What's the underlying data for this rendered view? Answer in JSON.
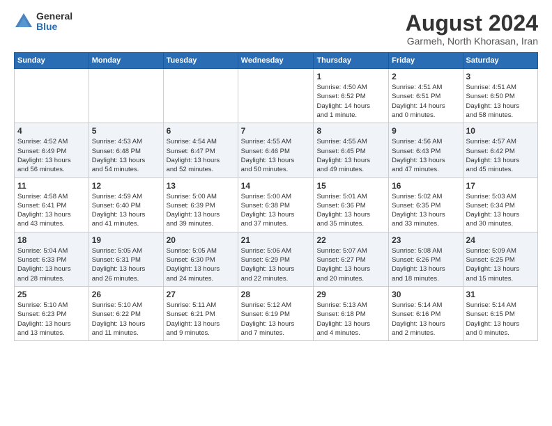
{
  "logo": {
    "general": "General",
    "blue": "Blue"
  },
  "title": "August 2024",
  "subtitle": "Garmeh, North Khorasan, Iran",
  "headers": [
    "Sunday",
    "Monday",
    "Tuesday",
    "Wednesday",
    "Thursday",
    "Friday",
    "Saturday"
  ],
  "weeks": [
    [
      {
        "day": "",
        "info": ""
      },
      {
        "day": "",
        "info": ""
      },
      {
        "day": "",
        "info": ""
      },
      {
        "day": "",
        "info": ""
      },
      {
        "day": "1",
        "info": "Sunrise: 4:50 AM\nSunset: 6:52 PM\nDaylight: 14 hours\nand 1 minute."
      },
      {
        "day": "2",
        "info": "Sunrise: 4:51 AM\nSunset: 6:51 PM\nDaylight: 14 hours\nand 0 minutes."
      },
      {
        "day": "3",
        "info": "Sunrise: 4:51 AM\nSunset: 6:50 PM\nDaylight: 13 hours\nand 58 minutes."
      }
    ],
    [
      {
        "day": "4",
        "info": "Sunrise: 4:52 AM\nSunset: 6:49 PM\nDaylight: 13 hours\nand 56 minutes."
      },
      {
        "day": "5",
        "info": "Sunrise: 4:53 AM\nSunset: 6:48 PM\nDaylight: 13 hours\nand 54 minutes."
      },
      {
        "day": "6",
        "info": "Sunrise: 4:54 AM\nSunset: 6:47 PM\nDaylight: 13 hours\nand 52 minutes."
      },
      {
        "day": "7",
        "info": "Sunrise: 4:55 AM\nSunset: 6:46 PM\nDaylight: 13 hours\nand 50 minutes."
      },
      {
        "day": "8",
        "info": "Sunrise: 4:55 AM\nSunset: 6:45 PM\nDaylight: 13 hours\nand 49 minutes."
      },
      {
        "day": "9",
        "info": "Sunrise: 4:56 AM\nSunset: 6:43 PM\nDaylight: 13 hours\nand 47 minutes."
      },
      {
        "day": "10",
        "info": "Sunrise: 4:57 AM\nSunset: 6:42 PM\nDaylight: 13 hours\nand 45 minutes."
      }
    ],
    [
      {
        "day": "11",
        "info": "Sunrise: 4:58 AM\nSunset: 6:41 PM\nDaylight: 13 hours\nand 43 minutes."
      },
      {
        "day": "12",
        "info": "Sunrise: 4:59 AM\nSunset: 6:40 PM\nDaylight: 13 hours\nand 41 minutes."
      },
      {
        "day": "13",
        "info": "Sunrise: 5:00 AM\nSunset: 6:39 PM\nDaylight: 13 hours\nand 39 minutes."
      },
      {
        "day": "14",
        "info": "Sunrise: 5:00 AM\nSunset: 6:38 PM\nDaylight: 13 hours\nand 37 minutes."
      },
      {
        "day": "15",
        "info": "Sunrise: 5:01 AM\nSunset: 6:36 PM\nDaylight: 13 hours\nand 35 minutes."
      },
      {
        "day": "16",
        "info": "Sunrise: 5:02 AM\nSunset: 6:35 PM\nDaylight: 13 hours\nand 33 minutes."
      },
      {
        "day": "17",
        "info": "Sunrise: 5:03 AM\nSunset: 6:34 PM\nDaylight: 13 hours\nand 30 minutes."
      }
    ],
    [
      {
        "day": "18",
        "info": "Sunrise: 5:04 AM\nSunset: 6:33 PM\nDaylight: 13 hours\nand 28 minutes."
      },
      {
        "day": "19",
        "info": "Sunrise: 5:05 AM\nSunset: 6:31 PM\nDaylight: 13 hours\nand 26 minutes."
      },
      {
        "day": "20",
        "info": "Sunrise: 5:05 AM\nSunset: 6:30 PM\nDaylight: 13 hours\nand 24 minutes."
      },
      {
        "day": "21",
        "info": "Sunrise: 5:06 AM\nSunset: 6:29 PM\nDaylight: 13 hours\nand 22 minutes."
      },
      {
        "day": "22",
        "info": "Sunrise: 5:07 AM\nSunset: 6:27 PM\nDaylight: 13 hours\nand 20 minutes."
      },
      {
        "day": "23",
        "info": "Sunrise: 5:08 AM\nSunset: 6:26 PM\nDaylight: 13 hours\nand 18 minutes."
      },
      {
        "day": "24",
        "info": "Sunrise: 5:09 AM\nSunset: 6:25 PM\nDaylight: 13 hours\nand 15 minutes."
      }
    ],
    [
      {
        "day": "25",
        "info": "Sunrise: 5:10 AM\nSunset: 6:23 PM\nDaylight: 13 hours\nand 13 minutes."
      },
      {
        "day": "26",
        "info": "Sunrise: 5:10 AM\nSunset: 6:22 PM\nDaylight: 13 hours\nand 11 minutes."
      },
      {
        "day": "27",
        "info": "Sunrise: 5:11 AM\nSunset: 6:21 PM\nDaylight: 13 hours\nand 9 minutes."
      },
      {
        "day": "28",
        "info": "Sunrise: 5:12 AM\nSunset: 6:19 PM\nDaylight: 13 hours\nand 7 minutes."
      },
      {
        "day": "29",
        "info": "Sunrise: 5:13 AM\nSunset: 6:18 PM\nDaylight: 13 hours\nand 4 minutes."
      },
      {
        "day": "30",
        "info": "Sunrise: 5:14 AM\nSunset: 6:16 PM\nDaylight: 13 hours\nand 2 minutes."
      },
      {
        "day": "31",
        "info": "Sunrise: 5:14 AM\nSunset: 6:15 PM\nDaylight: 13 hours\nand 0 minutes."
      }
    ]
  ]
}
